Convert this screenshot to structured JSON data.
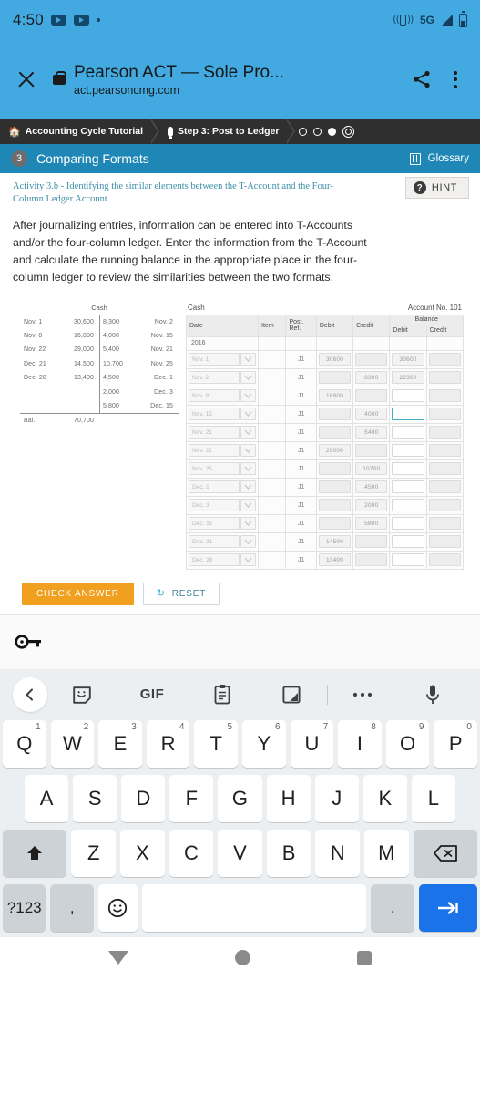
{
  "status_bar": {
    "time": "4:50",
    "network": "5G",
    "icons": [
      "youtube-icon",
      "youtube-icon",
      "dot-indicator",
      "vibrate-icon",
      "signal-icon",
      "battery-icon"
    ]
  },
  "browser": {
    "close_label": "close-icon",
    "lock_label": "lock-icon",
    "title": "Pearson ACT — Sole Pro...",
    "url": "act.pearsoncmg.com",
    "share_label": "share-icon",
    "menu_label": "more-options-icon"
  },
  "breadcrumb": {
    "items": [
      {
        "icon": "home-icon",
        "label": "Accounting Cycle Tutorial"
      },
      {
        "icon": "pin-icon",
        "label": "Step 3: Post to Ledger"
      }
    ],
    "step_dots": [
      "empty",
      "empty",
      "filled",
      "current"
    ]
  },
  "section": {
    "number": "3",
    "title": "Comparing Formats",
    "glossary_label": "Glossary",
    "glossary_icon": "book-icon"
  },
  "activity": {
    "hint_label": "HINT",
    "subtitle": "Activity 3.b - Identifying the similar elements between the T-Account and the Four-Column Ledger Account",
    "body": "After journalizing entries, information can be entered into T-Accounts and/or the four-column ledger. Enter the information from the T-Account and calculate the running balance in the appropriate place in the four-column ledger to review the similarities between the two formats."
  },
  "t_account": {
    "title": "Cash",
    "debit_entries": [
      {
        "date": "Nov. 1",
        "amount": "30,600"
      },
      {
        "date": "Nov. 8",
        "amount": "16,800"
      },
      {
        "date": "Nov. 22",
        "amount": "29,000"
      },
      {
        "date": "Dec. 21",
        "amount": "14,500"
      },
      {
        "date": "Dec. 28",
        "amount": "13,400"
      }
    ],
    "credit_entries": [
      {
        "amount": "8,300",
        "date": "Nov. 2"
      },
      {
        "amount": "4,000",
        "date": "Nov. 15"
      },
      {
        "amount": "5,400",
        "date": "Nov. 21"
      },
      {
        "amount": "10,700",
        "date": "Nov. 25"
      },
      {
        "amount": "4,500",
        "date": "Dec. 1"
      },
      {
        "amount": "2,000",
        "date": "Dec. 3"
      },
      {
        "amount": "5,800",
        "date": "Dec. 15"
      }
    ],
    "balance_label": "Bal.",
    "balance_amount": "70,700"
  },
  "ledger": {
    "account_name": "Cash",
    "account_no": "Account No. 101",
    "balance_group_label": "Balance",
    "headers": {
      "date": "Date",
      "item": "Item",
      "post_ref": "Post. Ref.",
      "debit": "Debit",
      "credit": "Credit",
      "bal_debit": "Debit",
      "bal_credit": "Credit"
    },
    "year": "2016",
    "rows": [
      {
        "date": "Nov. 1",
        "item": "",
        "ref": "J1",
        "debit": "30600",
        "credit": "",
        "bal_debit": "30600",
        "bal_credit": "",
        "bal_debit_state": "filled",
        "bal_credit_state": "empty"
      },
      {
        "date": "Nov. 2",
        "item": "",
        "ref": "J1",
        "debit": "",
        "credit": "8300",
        "bal_debit": "22300",
        "bal_credit": "",
        "bal_debit_state": "filled",
        "bal_credit_state": "empty"
      },
      {
        "date": "Nov. 8",
        "item": "",
        "ref": "J1",
        "debit": "16800",
        "credit": "",
        "bal_debit": "",
        "bal_credit": "",
        "bal_debit_state": "white",
        "bal_credit_state": "empty"
      },
      {
        "date": "Nov. 15",
        "item": "",
        "ref": "J1",
        "debit": "",
        "credit": "4000",
        "bal_debit": "",
        "bal_credit": "",
        "bal_debit_state": "focused",
        "bal_credit_state": "empty"
      },
      {
        "date": "Nov. 21",
        "item": "",
        "ref": "J1",
        "debit": "",
        "credit": "5400",
        "bal_debit": "",
        "bal_credit": "",
        "bal_debit_state": "white",
        "bal_credit_state": "empty"
      },
      {
        "date": "Nov. 22",
        "item": "",
        "ref": "J1",
        "debit": "29000",
        "credit": "",
        "bal_debit": "",
        "bal_credit": "",
        "bal_debit_state": "white",
        "bal_credit_state": "empty"
      },
      {
        "date": "Nov. 25",
        "item": "",
        "ref": "J1",
        "debit": "",
        "credit": "10700",
        "bal_debit": "",
        "bal_credit": "",
        "bal_debit_state": "white",
        "bal_credit_state": "empty"
      },
      {
        "date": "Dec. 1",
        "item": "",
        "ref": "J1",
        "debit": "",
        "credit": "4500",
        "bal_debit": "",
        "bal_credit": "",
        "bal_debit_state": "white",
        "bal_credit_state": "empty"
      },
      {
        "date": "Dec. 3",
        "item": "",
        "ref": "J1",
        "debit": "",
        "credit": "2000",
        "bal_debit": "",
        "bal_credit": "",
        "bal_debit_state": "white",
        "bal_credit_state": "empty"
      },
      {
        "date": "Dec. 15",
        "item": "",
        "ref": "J1",
        "debit": "",
        "credit": "5800",
        "bal_debit": "",
        "bal_credit": "",
        "bal_debit_state": "white",
        "bal_credit_state": "empty"
      },
      {
        "date": "Dec. 21",
        "item": "",
        "ref": "J1",
        "debit": "14500",
        "credit": "",
        "bal_debit": "",
        "bal_credit": "",
        "bal_debit_state": "white",
        "bal_credit_state": "empty"
      },
      {
        "date": "Dec. 28",
        "item": "",
        "ref": "J1",
        "debit": "13400",
        "credit": "",
        "bal_debit": "",
        "bal_credit": "",
        "bal_debit_state": "white",
        "bal_credit_state": "empty"
      }
    ]
  },
  "actions": {
    "check_label": "CHECK ANSWER",
    "reset_label": "RESET",
    "reset_icon": "refresh-icon",
    "key_icon": "key-icon"
  },
  "keyboard": {
    "toolbar": [
      "back-chevron-icon",
      "sticker-icon",
      "gif-label",
      "clipboard-icon",
      "handwriting-icon",
      "more-icon",
      "microphone-icon"
    ],
    "gif_label": "GIF",
    "row1": [
      {
        "key": "Q",
        "num": "1"
      },
      {
        "key": "W",
        "num": "2"
      },
      {
        "key": "E",
        "num": "3"
      },
      {
        "key": "R",
        "num": "4"
      },
      {
        "key": "T",
        "num": "5"
      },
      {
        "key": "Y",
        "num": "6"
      },
      {
        "key": "U",
        "num": "7"
      },
      {
        "key": "I",
        "num": "8"
      },
      {
        "key": "O",
        "num": "9"
      },
      {
        "key": "P",
        "num": "0"
      }
    ],
    "row2": [
      "A",
      "S",
      "D",
      "F",
      "G",
      "H",
      "J",
      "K",
      "L"
    ],
    "row3": {
      "shift": "shift-icon",
      "keys": [
        "Z",
        "X",
        "C",
        "V",
        "B",
        "N",
        "M"
      ],
      "backspace": "backspace-icon"
    },
    "row4": {
      "symbols": "?123",
      "comma": ",",
      "emoji": "emoji-icon",
      "space": "",
      "period": ".",
      "enter": "tab-next-icon"
    }
  },
  "navbar": {
    "back": "back-triangle-icon",
    "home": "home-circle-icon",
    "recents": "recents-square-icon"
  }
}
